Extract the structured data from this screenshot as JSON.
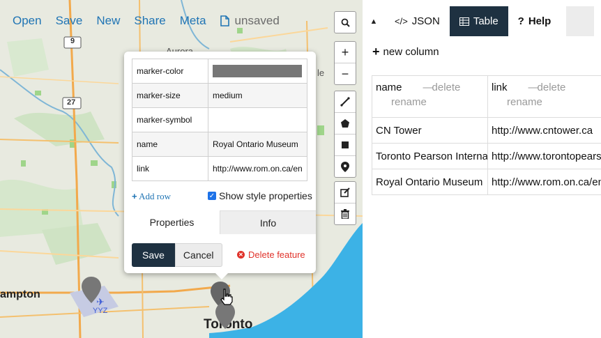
{
  "topmenu": {
    "items": [
      "Open",
      "Save",
      "New",
      "Share",
      "Meta"
    ],
    "status": "unsaved"
  },
  "map": {
    "labels": {
      "aurora": "Aurora",
      "ampton": "ampton",
      "toronto": "Toronto",
      "yyz": "YYZ",
      "hw9": "9",
      "hw27": "27",
      "le": "le"
    },
    "controls": {
      "zoom_in": "+",
      "zoom_out": "−"
    }
  },
  "popup": {
    "properties": [
      {
        "key": "marker-color",
        "value": "",
        "swatch": "#777777"
      },
      {
        "key": "marker-size",
        "value": "medium"
      },
      {
        "key": "marker-symbol",
        "value": ""
      },
      {
        "key": "name",
        "value": "Royal Ontario Museum"
      },
      {
        "key": "link",
        "value": "http://www.rom.on.ca/en"
      }
    ],
    "add_row": "Add row",
    "show_style": "Show style properties",
    "tabs": {
      "properties": "Properties",
      "info": "Info"
    },
    "save": "Save",
    "cancel": "Cancel",
    "delete": "Delete feature"
  },
  "panel": {
    "tabs": {
      "json": "JSON",
      "table": "Table",
      "help": "Help"
    },
    "new_column": "new column",
    "columns": [
      {
        "name": "name",
        "delete": "delete",
        "rename": "rename"
      },
      {
        "name": "link",
        "delete": "delete",
        "rename": "rename"
      }
    ],
    "rows": [
      {
        "name": "CN Tower",
        "link": "http://www.cntower.ca"
      },
      {
        "name": "Toronto Pearson International Airport",
        "link": "http://www.torontopearson.com"
      },
      {
        "name": "Royal Ontario Museum",
        "link": "http://www.rom.on.ca/en"
      }
    ]
  },
  "colors": {
    "accent": "#1f74b4",
    "dark": "#1e3141",
    "danger": "#e0332b",
    "water": "#3cb2e6",
    "marker": "#777777"
  }
}
